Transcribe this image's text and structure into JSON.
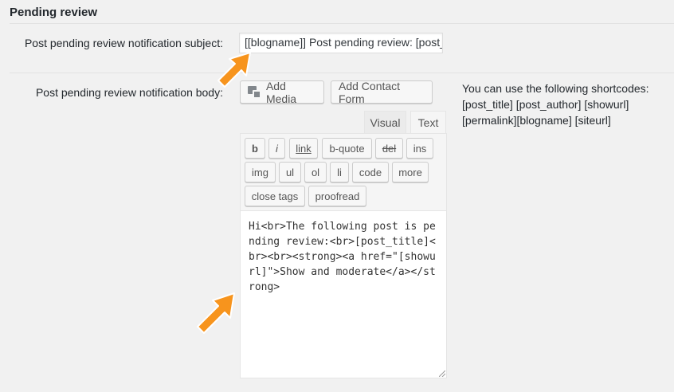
{
  "section": {
    "title": "Pending review"
  },
  "subject": {
    "label": "Post pending review notification subject:",
    "value": "[[blogname]] Post pending review: [post_title]"
  },
  "body": {
    "label": "Post pending review notification body:",
    "add_media_label": "Add Media",
    "add_contact_form_label": "Add Contact Form",
    "tabs": {
      "visual": "Visual",
      "text": "Text"
    },
    "quicktags": {
      "b": "b",
      "i": "i",
      "link": "link",
      "bquote": "b-quote",
      "del": "del",
      "ins": "ins",
      "img": "img",
      "ul": "ul",
      "ol": "ol",
      "li": "li",
      "code": "code",
      "more": "more",
      "close": "close tags",
      "proofread": "proofread"
    },
    "content": "Hi<br>The following post is pending review:<br>[post_title]<br><br><strong><a href=\"[showurl]\">Show and moderate</a></strong>"
  },
  "shortcodes": {
    "text": "You can use the following shortcodes: [post_title] [post_author] [showurl] [permalink][blogname] [siteurl]"
  },
  "colors": {
    "arrow": "#f7941d",
    "background": "#f1f1f1"
  },
  "icons": {
    "media": "media-icon",
    "resize": "resize-handle-icon",
    "arrow": "arrow-pointer-icon"
  }
}
